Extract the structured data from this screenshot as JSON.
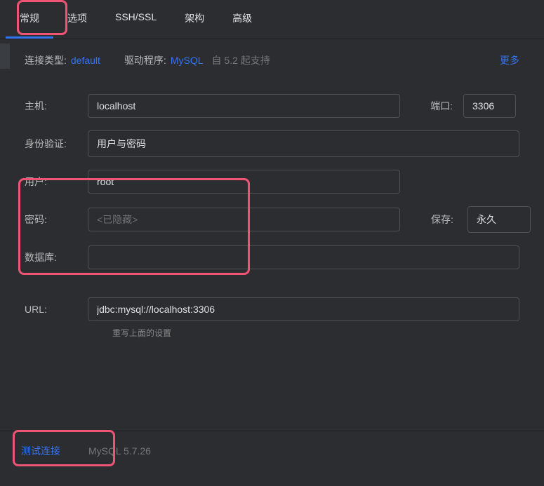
{
  "tabs": {
    "general": "常规",
    "options": "选项",
    "sshssl": "SSH/SSL",
    "schemas": "架构",
    "advanced": "高级"
  },
  "info": {
    "connection_type_label": "连接类型:",
    "connection_type_value": "default",
    "driver_label": "驱动程序:",
    "driver_value": "MySQL",
    "version_hint": "自 5.2 起支持",
    "more": "更多"
  },
  "form": {
    "host_label": "主机:",
    "host_value": "localhost",
    "port_label": "端口:",
    "port_value": "3306",
    "auth_label": "身份验证:",
    "auth_value": "用户与密码",
    "user_label": "用户:",
    "user_value": "root",
    "password_label": "密码:",
    "password_placeholder": "<已隐藏>",
    "save_label": "保存:",
    "save_value": "永久",
    "database_label": "数据库:",
    "database_value": "",
    "url_label": "URL:",
    "url_value": "jdbc:mysql://localhost:3306",
    "url_hint": "重写上面的设置"
  },
  "footer": {
    "test_connection": "测试连接",
    "version": "MySQL 5.7.26"
  }
}
